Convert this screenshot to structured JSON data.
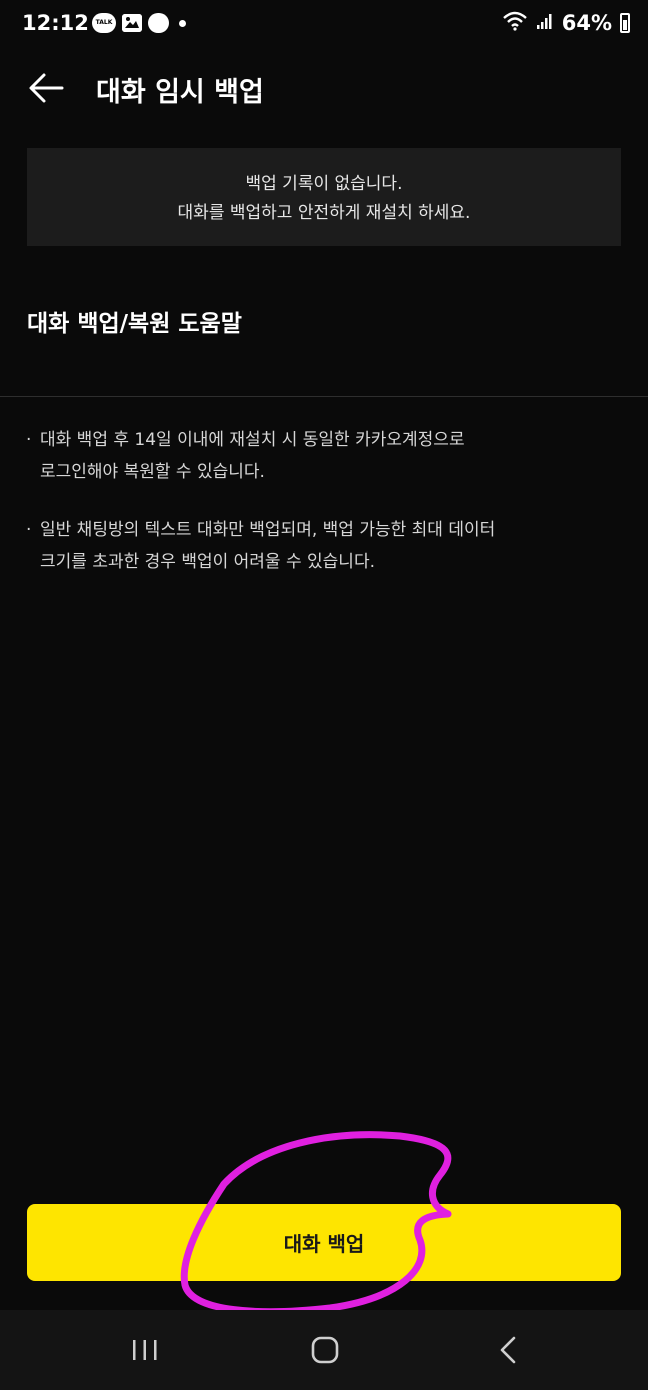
{
  "status_bar": {
    "time": "12:12",
    "talk_badge": "TALK",
    "battery": "64%"
  },
  "header": {
    "title": "대화 임시 백업"
  },
  "notice": {
    "line1": "백업 기록이 없습니다.",
    "line2": "대화를 백업하고 안전하게 재설치 하세요."
  },
  "help": {
    "heading": "대화 백업/복원 도움말",
    "bullets": [
      {
        "line1": "대화 백업 후 14일 이내에 재설치 시 동일한 카카오계정으로",
        "line2": "로그인해야 복원할 수 있습니다."
      },
      {
        "line1": "일반 채팅방의 텍스트 대화만 백업되며, 백업 가능한 최대 데이터",
        "line2": "크기를 초과한 경우 백업이 어려울 수 있습니다."
      }
    ]
  },
  "action": {
    "button_label": "대화 백업"
  },
  "colors": {
    "background": "#0a0a0a",
    "notice_bg": "#1c1c1c",
    "accent_yellow": "#fee500",
    "annotation_magenta": "#e020e0"
  },
  "icons": {
    "back": "arrow-left-icon",
    "nav_recents": "recent-apps-icon",
    "nav_home": "home-icon",
    "nav_back": "chevron-left-icon"
  }
}
